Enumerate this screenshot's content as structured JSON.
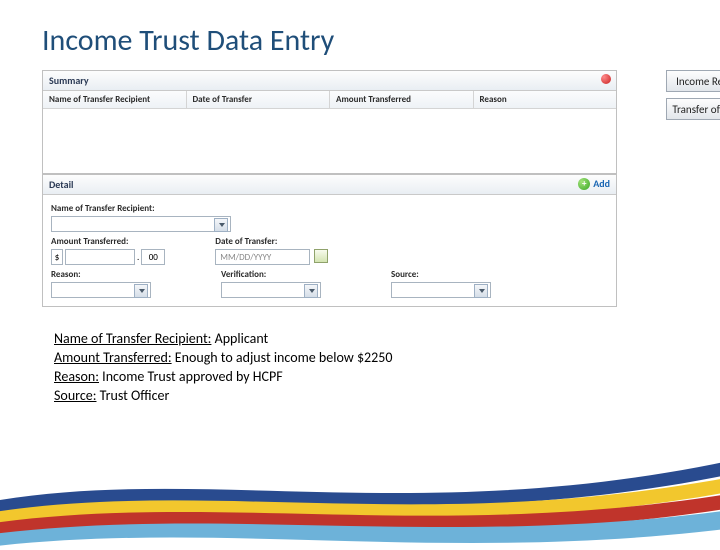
{
  "title": "Income Trust Data Entry",
  "summary": {
    "panelTitle": "Summary",
    "cols": [
      "Name of Transfer Recipient",
      "Date of Transfer",
      "Amount Transferred",
      "Reason"
    ]
  },
  "detail": {
    "panelTitle": "Detail",
    "addLabel": "Add",
    "fields": {
      "recipientLabel": "Name of Transfer Recipient:",
      "amountLabel": "Amount Transferred:",
      "amountPrefix": "$",
      "amountCents": "00",
      "dateLabel": "Date of Transfer:",
      "datePlaceholder": "MM/DD/YYYY",
      "reasonLabel": "Reason:",
      "verificationLabel": "Verification:",
      "sourceLabel": "Source:"
    }
  },
  "sideButtons": {
    "incomeReceived": "Income Received",
    "transferOfIncome": "Transfer of Income"
  },
  "instructions": {
    "l1label": "Name of Transfer Recipient:",
    "l1value": " Applicant",
    "l2label": "Amount Transferred:",
    "l2value": " Enough to adjust income below $2250",
    "l3label": "Reason:",
    "l3value": " Income Trust approved by HCPF",
    "l4label": "Source:",
    "l4value": " Trust Officer"
  }
}
